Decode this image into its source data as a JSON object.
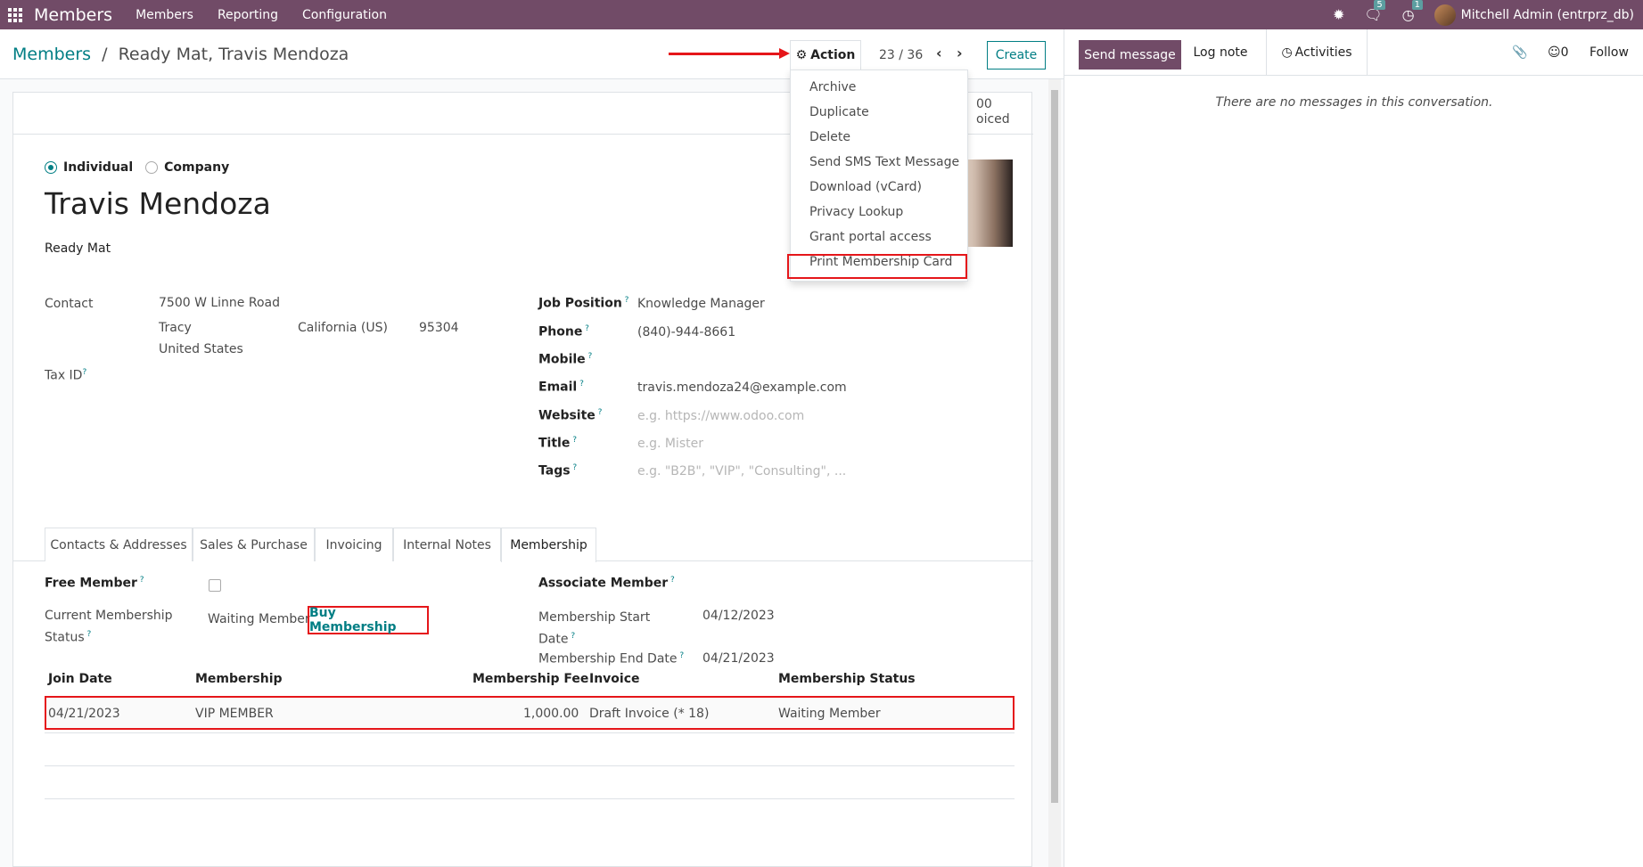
{
  "navbar": {
    "app": "Members",
    "menus": [
      "Members",
      "Reporting",
      "Configuration"
    ],
    "chat_badge": "5",
    "activity_badge": "1",
    "user": "Mitchell Admin (entrprz_db)"
  },
  "breadcrumb": {
    "parent": "Members",
    "separator": "/",
    "current": "Ready Mat, Travis Mendoza"
  },
  "control": {
    "action": "Action",
    "pager": "23 / 36",
    "create": "Create"
  },
  "action_menu": [
    "Archive",
    "Duplicate",
    "Delete",
    "Send SMS Text Message",
    "Download (vCard)",
    "Privacy Lookup",
    "Grant portal access",
    "Print Membership Card"
  ],
  "stat_partial": {
    "line1": "00",
    "line2": "oiced"
  },
  "form": {
    "type_individual": "Individual",
    "type_company": "Company",
    "name": "Travis Mendoza",
    "company": "Ready Mat",
    "contact_label": "Contact",
    "street": "7500 W Linne Road",
    "city": "Tracy",
    "state": "California (US)",
    "zip": "95304",
    "country": "United States",
    "tax_id_label": "Tax ID",
    "job_position_label": "Job Position",
    "job_position": "Knowledge Manager",
    "phone_label": "Phone",
    "phone": "(840)-944-8661",
    "mobile_label": "Mobile",
    "email_label": "Email",
    "email": "travis.mendoza24@example.com",
    "website_label": "Website",
    "website_placeholder": "e.g. https://www.odoo.com",
    "title_label": "Title",
    "title_placeholder": "e.g. Mister",
    "tags_label": "Tags",
    "tags_placeholder": "e.g. \"B2B\", \"VIP\", \"Consulting\", ..."
  },
  "tabs": [
    "Contacts & Addresses",
    "Sales & Purchase",
    "Invoicing",
    "Internal Notes",
    "Membership"
  ],
  "membership": {
    "free_member_label": "Free Member",
    "current_status_label_1": "Current Membership",
    "current_status_label_2": "Status",
    "current_status": "Waiting Member",
    "buy_button": "Buy Membership",
    "associate_label": "Associate Member",
    "start_label_1": "Membership Start",
    "start_label_2": "Date",
    "start_date": "04/12/2023",
    "end_label": "Membership End Date",
    "end_date": "04/21/2023"
  },
  "table": {
    "headers": [
      "Join Date",
      "Membership",
      "Membership Fee",
      "Invoice",
      "Membership Status"
    ],
    "rows": [
      {
        "join_date": "04/21/2023",
        "membership": "VIP MEMBER",
        "fee": "1,000.00",
        "invoice": "Draft Invoice (* 18)",
        "status": "Waiting Member"
      }
    ]
  },
  "chatter": {
    "send": "Send message",
    "log": "Log note",
    "activities": "Activities",
    "followers": "0",
    "follow": "Follow",
    "empty": "There are no messages in this conversation."
  },
  "colors": {
    "brand": "#714b67",
    "accent": "#017e84",
    "highlight": "#e5161a"
  }
}
